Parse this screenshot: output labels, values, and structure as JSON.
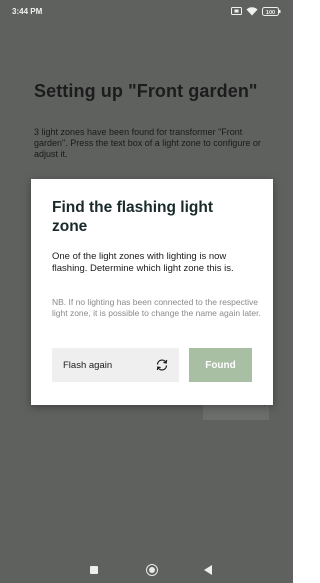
{
  "status_bar": {
    "time": "3:44 PM",
    "icons": [
      "screen-record-icon",
      "wifi-icon",
      "battery-icon"
    ],
    "battery_level": "100"
  },
  "page": {
    "title": "Setting up \"Front garden\"",
    "description": "3 light zones have been found for transformer \"Front garden\". Press the text box of a light zone to configure or adjust it."
  },
  "dialog": {
    "title": "Find the flashing light zone",
    "body": "One of the light zones with lighting is now flashing. Determine which light zone this is.",
    "note": "NB. If no lighting has been connected to the respective light zone, it is possible to change the name again later.",
    "flash_again_label": "Flash again",
    "flash_again_icon": "refresh-icon",
    "found_label": "Found"
  },
  "nav_bar": {
    "icons": [
      "recent-apps-icon",
      "home-icon",
      "back-icon"
    ]
  },
  "colors": {
    "overlay_background": "#5f615f",
    "dialog_background": "#ffffff",
    "found_button": "#a8bfa4",
    "flash_button": "#efefef",
    "note_text": "#8a8a8a"
  }
}
